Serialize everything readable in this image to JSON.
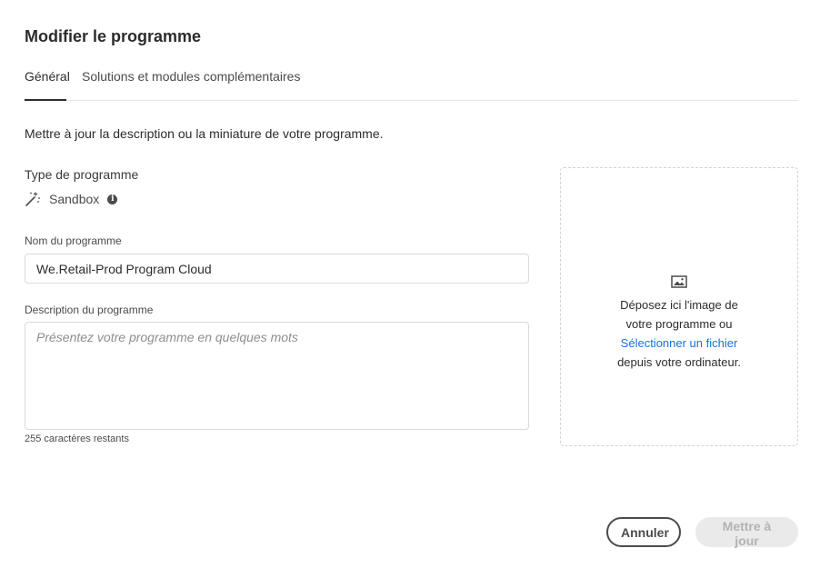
{
  "dialog": {
    "title": "Modifier le programme",
    "tabs": [
      {
        "label": "Général",
        "active": true
      },
      {
        "label": "Solutions et modules complémentaires",
        "active": false
      }
    ],
    "intro": "Mettre à jour la description ou la miniature de votre programme.",
    "program_type": {
      "label": "Type de programme",
      "value": "Sandbox",
      "icon": "magic-wand-icon",
      "info_icon": "info-icon"
    },
    "name_field": {
      "label": "Nom du programme",
      "value": "We.Retail-Prod Program Cloud"
    },
    "description_field": {
      "label": "Description du programme",
      "value": "",
      "placeholder": "Présentez votre programme en quelques mots",
      "remaining": "255 caractères restants"
    },
    "dropzone": {
      "icon": "image-icon",
      "line1": "Déposez ici l'image de",
      "line2": "votre programme ou",
      "link": "Sélectionner un fichier",
      "line3": "depuis votre ordinateur."
    },
    "buttons": {
      "cancel": "Annuler",
      "update": "Mettre à jour",
      "update_disabled": true
    },
    "colors": {
      "accent": "#1473e6",
      "text": "#2c2c2c",
      "border": "#dadada"
    }
  }
}
